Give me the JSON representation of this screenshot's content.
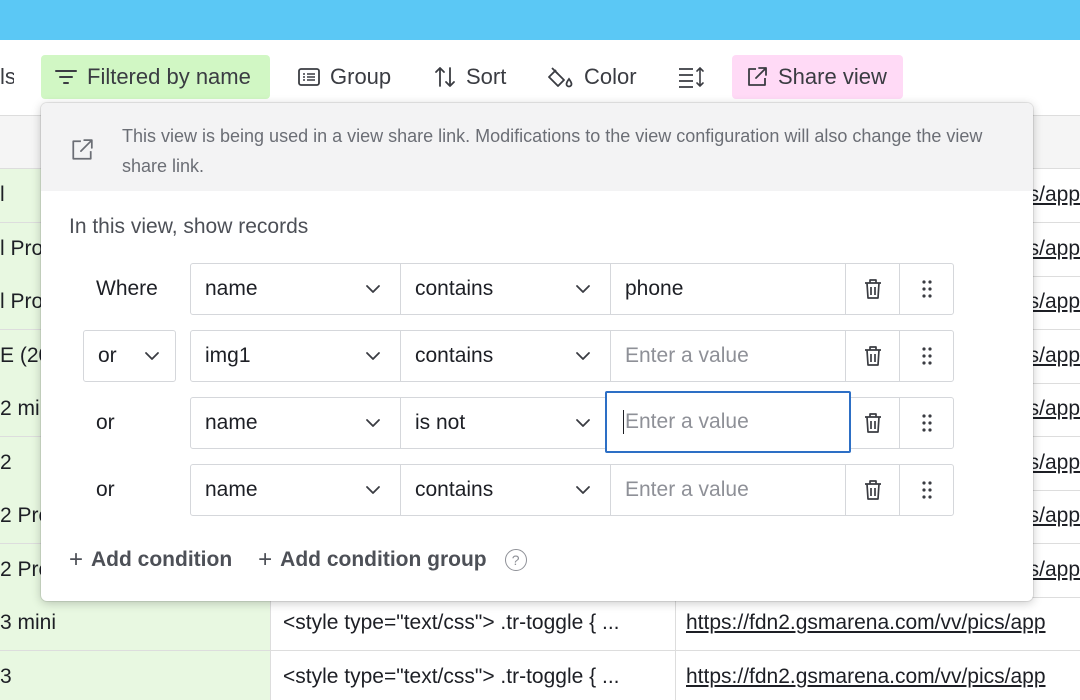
{
  "toolbar": {
    "partial_label": "ls",
    "filter_label": "Filtered by name",
    "group_label": "Group",
    "sort_label": "Sort",
    "color_label": "Color",
    "share_label": "Share view"
  },
  "grid": {
    "rows": [
      {
        "name": "l",
        "mid": "",
        "link": "s/app"
      },
      {
        "name": "l Pro",
        "mid": "",
        "link": "s/app"
      },
      {
        "name": "l Pro",
        "mid": "",
        "link": "s/app"
      },
      {
        "name": "E (20",
        "mid": "",
        "link": "s/app"
      },
      {
        "name": "2 min",
        "mid": "",
        "link": "s/app"
      },
      {
        "name": "2",
        "mid": "",
        "link": "s/app"
      },
      {
        "name": "2 Pro",
        "mid": "",
        "link": "s/app"
      },
      {
        "name": "2 Pro",
        "mid": "",
        "link": "s/app"
      },
      {
        "name": "3 mini",
        "mid": "<style type=\"text/css\"> .tr-toggle { ...",
        "link": "https://fdn2.gsmarena.com/vv/pics/app"
      },
      {
        "name": "3",
        "mid": "<style type=\"text/css\"> .tr-toggle { ...",
        "link": "https://fdn2.gsmarena.com/vv/pics/app"
      }
    ]
  },
  "popover": {
    "notice": "This view is being used in a view share link. Modifications to the view configuration will also change the view share link.",
    "section_title": "In this view, show records",
    "conditions": [
      {
        "conjunction": "Where",
        "field": "name",
        "operator": "contains",
        "value": "phone",
        "placeholder": "Enter a value"
      },
      {
        "conjunction": "or",
        "field": "img1",
        "operator": "contains",
        "value": "",
        "placeholder": "Enter a value"
      },
      {
        "conjunction": "or",
        "field": "name",
        "operator": "is not",
        "value": "",
        "placeholder": "Enter a value"
      },
      {
        "conjunction": "or",
        "field": "name",
        "operator": "contains",
        "value": "",
        "placeholder": "Enter a value"
      }
    ],
    "add_condition": "Add condition",
    "add_condition_group": "Add condition group",
    "help_glyph": "?"
  },
  "colors": {
    "topbar": "#5bc8f5",
    "filter_bg": "#d1f7c4",
    "share_bg": "#ffdaf6",
    "focus_border": "#2d6fc5"
  }
}
